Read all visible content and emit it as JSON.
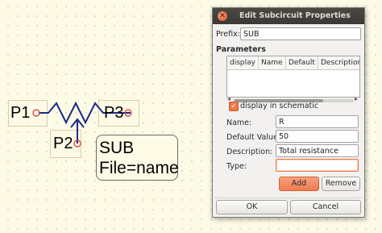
{
  "schematic": {
    "pins": [
      "P1",
      "P2",
      "P3"
    ],
    "symbol_text": [
      "SUB",
      "File=name"
    ]
  },
  "dialog": {
    "title": "Edit Subcircuit Properties",
    "close_glyph": "✕",
    "prefix_label": "Prefix:",
    "prefix_value": "SUB",
    "parameters_heading": "Parameters",
    "table_headers": [
      "display",
      "Name",
      "Default",
      "Description"
    ],
    "display_in_schematic_label": "display in schematic",
    "display_in_schematic_checked": true,
    "name_label": "Name:",
    "name_value": "R",
    "default_label": "Default Value:",
    "default_value": "50",
    "description_label": "Description:",
    "description_value": "Total resistance",
    "type_label": "Type:",
    "type_value": "",
    "add_label": "Add",
    "remove_label": "Remove",
    "ok_label": "OK",
    "cancel_label": "Cancel"
  },
  "colors": {
    "accent": "#f07746",
    "wire": "#1a2a8c",
    "pin_circle": "#e03030",
    "titlebar": "#3c3b37"
  }
}
